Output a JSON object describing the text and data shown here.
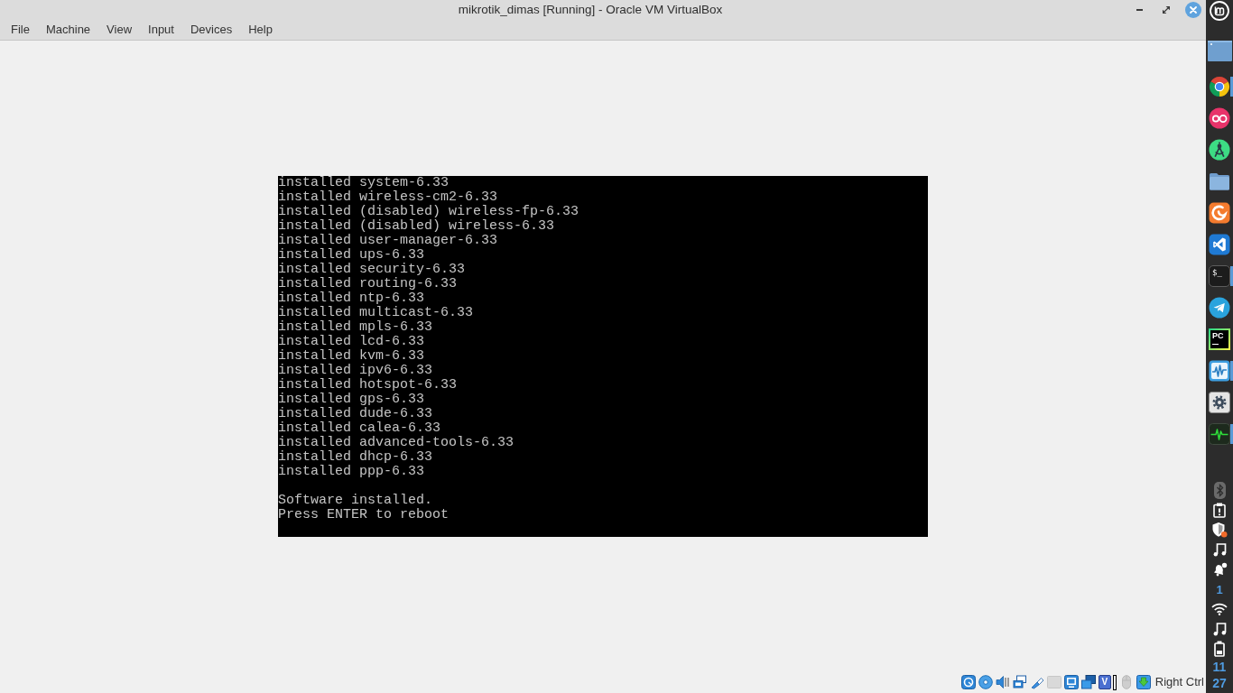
{
  "window": {
    "title": "mikrotik_dimas [Running] - Oracle VM VirtualBox"
  },
  "menu": [
    "File",
    "Machine",
    "View",
    "Input",
    "Devices",
    "Help"
  ],
  "vm_screen": {
    "log": [
      "installed system-6.33",
      "installed wireless-cm2-6.33",
      "installed (disabled) wireless-fp-6.33",
      "installed (disabled) wireless-6.33",
      "installed user-manager-6.33",
      "installed ups-6.33",
      "installed security-6.33",
      "installed routing-6.33",
      "installed ntp-6.33",
      "installed multicast-6.33",
      "installed mpls-6.33",
      "installed lcd-6.33",
      "installed kvm-6.33",
      "installed ipv6-6.33",
      "installed hotspot-6.33",
      "installed gps-6.33",
      "installed dude-6.33",
      "installed calea-6.33",
      "installed advanced-tools-6.33",
      "installed dhcp-6.33",
      "installed ppp-6.33"
    ],
    "messages": [
      "Software installed.",
      "Press ENTER to reboot"
    ]
  },
  "status_bar": {
    "indicators": [
      {
        "kind": "hard-disk",
        "disabled": false
      },
      {
        "kind": "optical-disc",
        "disabled": false
      },
      {
        "kind": "audio",
        "disabled": false
      },
      {
        "kind": "network",
        "disabled": false
      },
      {
        "kind": "usb",
        "disabled": false
      },
      {
        "kind": "shared-folders",
        "disabled": true
      },
      {
        "kind": "display",
        "disabled": false
      },
      {
        "kind": "recording",
        "disabled": false
      },
      {
        "kind": "cpu",
        "label": "V",
        "disabled": false
      },
      {
        "kind": "mouse",
        "disabled": true
      },
      {
        "kind": "keyboard",
        "disabled": false
      }
    ],
    "host_key": "Right Ctrl"
  },
  "dock": {
    "launchers": [
      {
        "kind": "browser",
        "running": true
      },
      {
        "kind": "rings",
        "running": false
      },
      {
        "kind": "compass",
        "running": false
      },
      {
        "kind": "folder",
        "running": false
      },
      {
        "kind": "swirl",
        "running": false
      },
      {
        "kind": "editor",
        "running": false
      },
      {
        "kind": "terminal",
        "label": "$_",
        "running": true
      },
      {
        "kind": "messenger",
        "running": false
      },
      {
        "kind": "ide",
        "label": "PC",
        "running": false
      },
      {
        "kind": "pulse-monitor",
        "running": true
      },
      {
        "kind": "settings",
        "running": false
      },
      {
        "kind": "heartbeat",
        "running": true
      }
    ],
    "tray": {
      "notification_count": "1",
      "clock": {
        "hour": "11",
        "minute": "27"
      }
    }
  }
}
